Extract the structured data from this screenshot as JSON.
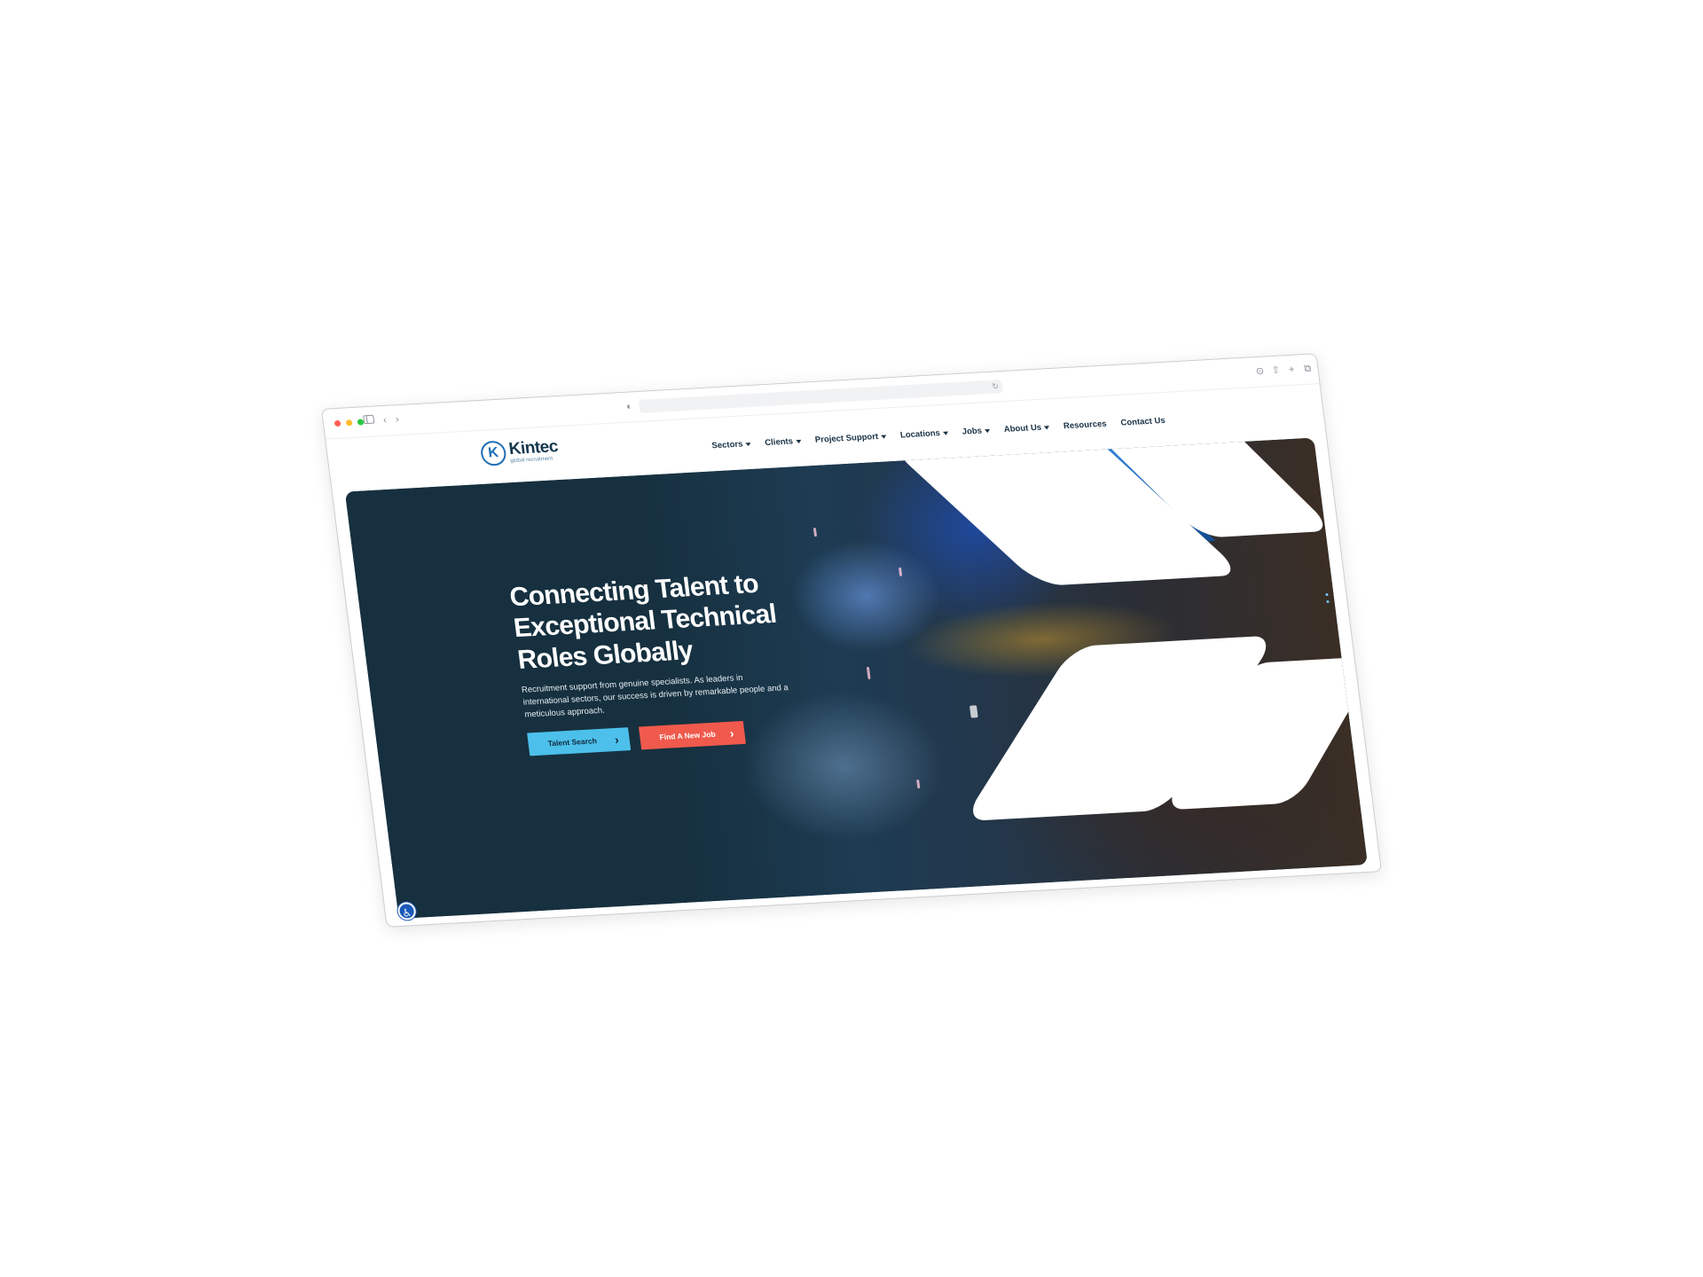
{
  "browser": {
    "toolbar_icons": [
      "sidebar-icon",
      "back-icon",
      "forward-icon",
      "shield-icon",
      "reload-icon",
      "download-icon",
      "share-icon",
      "new-tab-icon",
      "tabs-icon"
    ]
  },
  "site": {
    "logo": {
      "name": "Kintec",
      "tagline": "global recruitment"
    },
    "nav": [
      {
        "label": "Sectors",
        "has_dropdown": true
      },
      {
        "label": "Clients",
        "has_dropdown": true
      },
      {
        "label": "Project Support",
        "has_dropdown": true
      },
      {
        "label": "Locations",
        "has_dropdown": true
      },
      {
        "label": "Jobs",
        "has_dropdown": true
      },
      {
        "label": "About Us",
        "has_dropdown": true
      },
      {
        "label": "Resources",
        "has_dropdown": false
      },
      {
        "label": "Contact Us",
        "has_dropdown": false
      }
    ]
  },
  "hero": {
    "title": "Connecting Talent to Exceptional Technical Roles Globally",
    "text": "Recruitment support from genuine specialists. As leaders in international sectors, our success is driven by remarkable people and a meticulous approach.",
    "primary_button": "Talent Search",
    "secondary_button": "Find A New Job"
  },
  "colors": {
    "brand_dark": "#16384f",
    "brand_blue": "#1e6fb5",
    "talent_button": "#4cc0ea",
    "find_job_button": "#ef5a4c",
    "hero_bg": "#16303f"
  }
}
